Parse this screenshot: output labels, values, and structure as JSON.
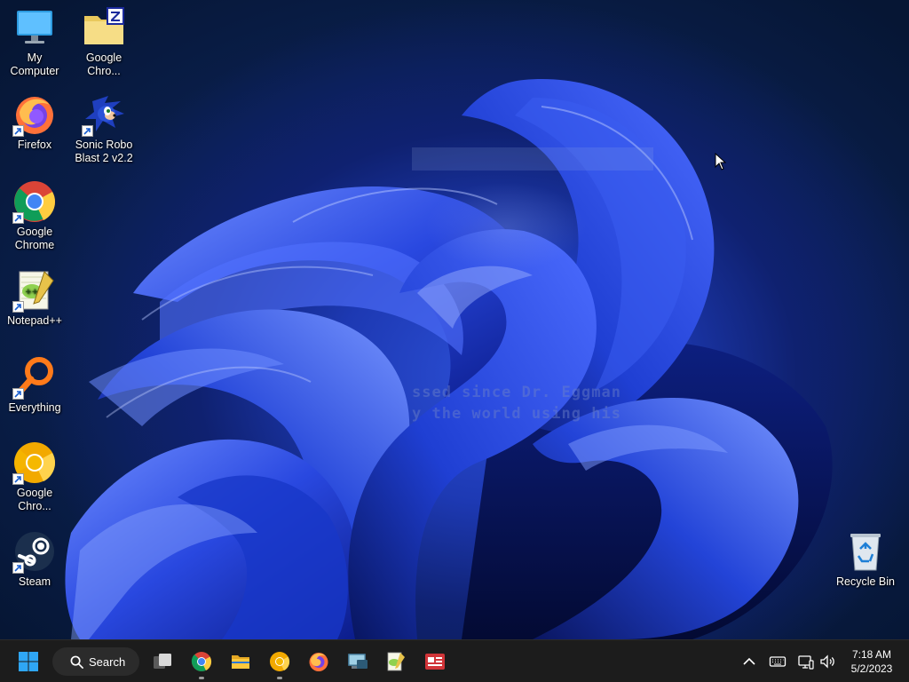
{
  "desktop": {
    "icons": [
      {
        "label": "My Computer",
        "icon": "monitor-icon"
      },
      {
        "label": "Google Chro...",
        "icon": "zip-folder-icon"
      },
      {
        "label": "Firefox",
        "icon": "firefox-icon"
      },
      {
        "label": "Sonic Robo Blast 2 v2.2",
        "icon": "sonic-icon"
      },
      {
        "label": "Google Chrome",
        "icon": "chrome-icon"
      },
      {
        "label": "Notepad++",
        "icon": "notepadpp-icon"
      },
      {
        "label": "Everything",
        "icon": "search-magnifier-icon"
      },
      {
        "label": "Google Chro...",
        "icon": "chrome-canary-icon"
      },
      {
        "label": "Steam",
        "icon": "steam-icon"
      },
      {
        "label": "Recycle Bin",
        "icon": "recycle-bin-icon"
      }
    ],
    "overlay_text": [
      "ssed since Dr. Eggman",
      "y the world using his"
    ]
  },
  "taskbar": {
    "search_label": "Search",
    "apps": [
      "start",
      "task-view",
      "chrome",
      "file-explorer",
      "chrome-canary",
      "firefox",
      "remote-desktop",
      "notepadpp",
      "news"
    ],
    "clock": {
      "time": "7:18 AM",
      "date": "5/2/2023"
    }
  },
  "colors": {
    "taskbar_bg": "#1c1c1c",
    "wallpaper_accent": "#2c4fd6",
    "start_blue": "#2fa6f5"
  }
}
